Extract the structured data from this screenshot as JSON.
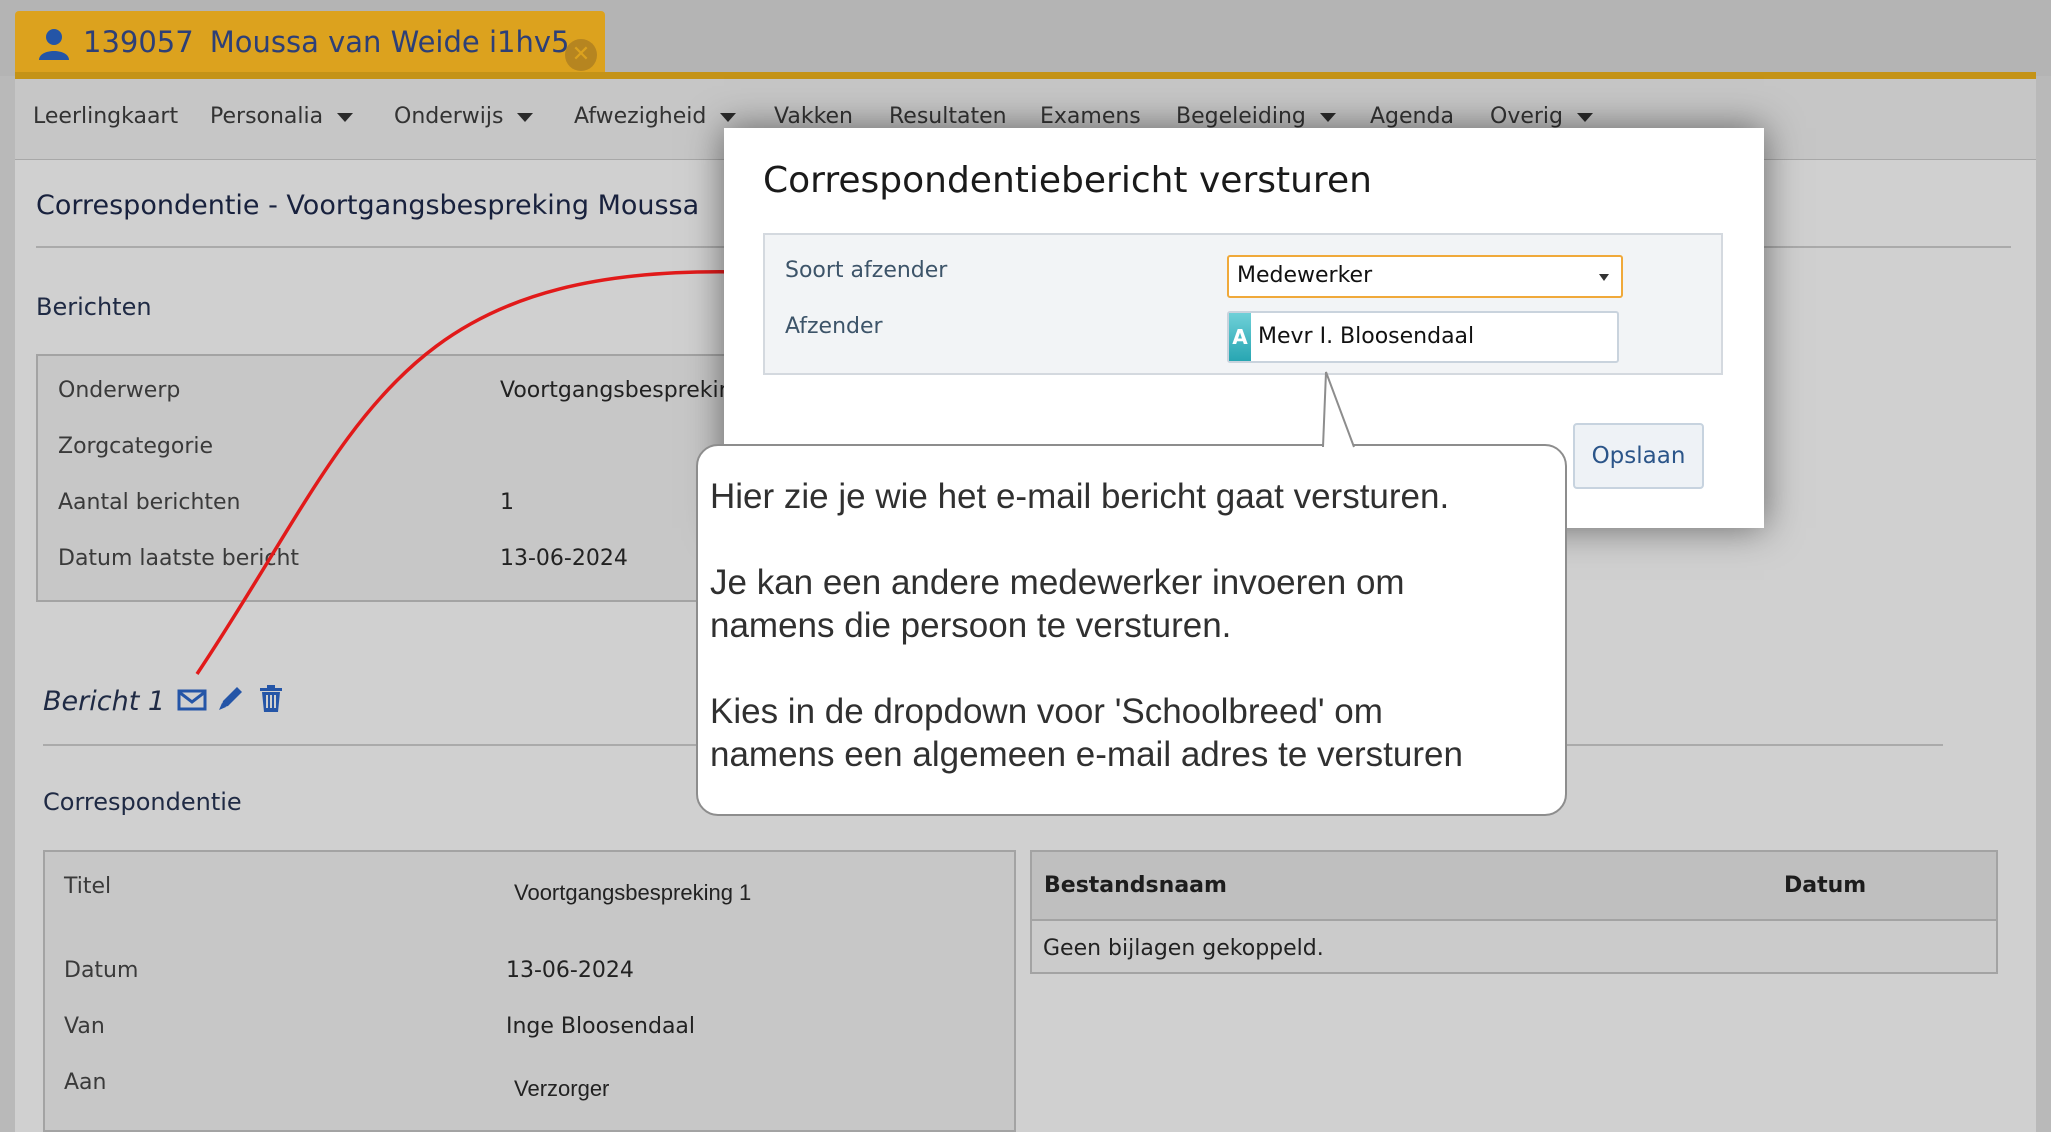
{
  "student_tab": {
    "id": "139057",
    "name": "Moussa van Weide i1hv5"
  },
  "menu": [
    {
      "label": "Leerlingkaart",
      "dropdown": false
    },
    {
      "label": "Personalia",
      "dropdown": true
    },
    {
      "label": "Onderwijs",
      "dropdown": true
    },
    {
      "label": "Afwezigheid",
      "dropdown": true
    },
    {
      "label": "Vakken",
      "dropdown": false
    },
    {
      "label": "Resultaten",
      "dropdown": false
    },
    {
      "label": "Examens",
      "dropdown": false
    },
    {
      "label": "Begeleiding",
      "dropdown": true
    },
    {
      "label": "Agenda",
      "dropdown": false
    },
    {
      "label": "Overig",
      "dropdown": true
    }
  ],
  "page": {
    "title": "Correspondentie - Voortgangsbespreking Moussa",
    "berichten_header": "Berichten",
    "summary": [
      {
        "label": "Onderwerp",
        "value": "Voortgangsbespreking"
      },
      {
        "label": "Zorgcategorie",
        "value": ""
      },
      {
        "label": "Aantal berichten",
        "value": "1"
      },
      {
        "label": "Datum laatste bericht",
        "value": "13-06-2024"
      }
    ],
    "bericht_label": "Bericht 1",
    "correspondentie_header": "Correspondentie",
    "details": [
      {
        "label": "Titel",
        "value": "Voortgangsbespreking 1"
      },
      {
        "label": "Datum",
        "value": "13-06-2024"
      },
      {
        "label": "Van",
        "value": "Inge Bloosendaal"
      },
      {
        "label": "Aan",
        "value": "Verzorger"
      }
    ],
    "attachments": {
      "col_name": "Bestandsnaam",
      "col_date": "Datum",
      "empty_text": "Geen bijlagen gekoppeld."
    }
  },
  "modal": {
    "title": "Correspondentiebericht versturen",
    "soort_label": "Soort afzender",
    "soort_value": "Medewerker",
    "afzender_label": "Afzender",
    "afzender_value": "Mevr I. Bloosendaal",
    "afzender_badge": "A",
    "save_label": "Opslaan"
  },
  "callout": {
    "line1": "Hier zie je wie het e-mail bericht gaat versturen.",
    "line2": "Je kan een andere medewerker invoeren om",
    "line3": "namens die persoon te versturen.",
    "line4": "Kies in de dropdown voor 'Schoolbreed' om",
    "line5": "namens een algemeen e-mail adres te versturen"
  },
  "colors": {
    "tab_gold": "#dca21e",
    "icon_blue": "#2455a7",
    "arrow_red": "#e11a1a",
    "select_focus": "#f0a93a",
    "save_text": "#2b5589"
  },
  "icons": [
    "person-icon",
    "close-circle-icon",
    "envelope-icon",
    "pencil-icon",
    "trash-icon",
    "caret-down-icon"
  ]
}
